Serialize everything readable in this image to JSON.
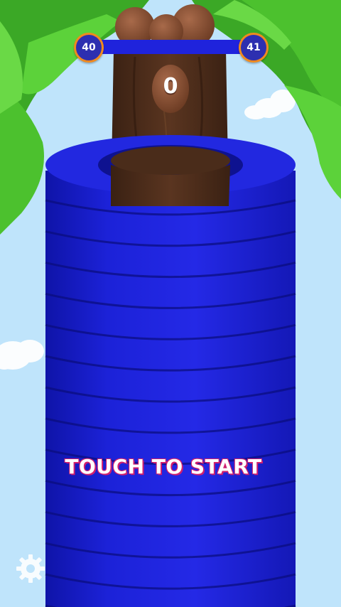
{
  "hud": {
    "level_current": "40",
    "level_next": "41",
    "level_progress": 0,
    "score": "0"
  },
  "overlay": {
    "start_prompt": "TOUCH TO START"
  },
  "scene": {
    "ring_count": 14,
    "colors": {
      "sky": "#bfe4fb",
      "leaves": "#4cc12e",
      "trunk": "#4a2c1a",
      "rings": "#1a1fd8",
      "coconut": "#8a4e32",
      "badge_border": "#f08a1e",
      "start_text_outline": "#d21f6e"
    }
  },
  "icons": {
    "settings": "gear-icon"
  }
}
